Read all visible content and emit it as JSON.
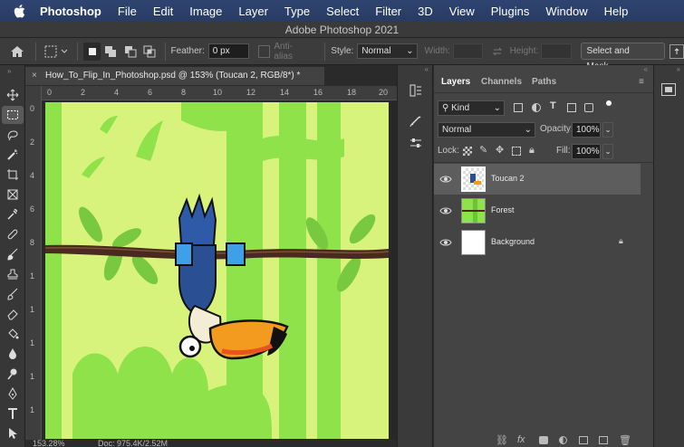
{
  "menubar": {
    "items": [
      "Photoshop",
      "File",
      "Edit",
      "Image",
      "Layer",
      "Type",
      "Select",
      "Filter",
      "3D",
      "View",
      "Plugins",
      "Window",
      "Help"
    ]
  },
  "window": {
    "title": "Adobe Photoshop 2021"
  },
  "options": {
    "feather_label": "Feather:",
    "feather_value": "0 px",
    "antialias_label": "Anti-alias",
    "style_label": "Style:",
    "style_value": "Normal",
    "width_label": "Width:",
    "height_label": "Height:",
    "select_mask_label": "Select and Mask..."
  },
  "document": {
    "tab_title": "How_To_Flip_In_Photoshop.psd @ 153% (Toucan 2, RGB/8*) *",
    "ruler_h": [
      "0",
      "2",
      "4",
      "6",
      "8",
      "10",
      "12",
      "14",
      "16",
      "18",
      "20"
    ],
    "ruler_v": [
      "0",
      "2",
      "4",
      "6",
      "8",
      "1",
      "1",
      "1",
      "1",
      "1"
    ],
    "zoom": "153.28%",
    "doc_size": "Doc: 975.4K/2.52M"
  },
  "layers_panel": {
    "tabs": [
      "Layers",
      "Channels",
      "Paths"
    ],
    "filter_kind": "Kind",
    "blend_mode": "Normal",
    "opacity_label": "Opacity:",
    "opacity_value": "100%",
    "lock_label": "Lock:",
    "fill_label": "Fill:",
    "fill_value": "100%",
    "layers": [
      {
        "name": "Toucan 2",
        "selected": true
      },
      {
        "name": "Forest",
        "selected": false
      },
      {
        "name": "Background",
        "selected": false,
        "locked": true
      }
    ]
  },
  "colors": {
    "menubar": "#2b3f6a",
    "canvas_bg": "#d6f27a",
    "forest": "#8ee04a",
    "branch": "#4a2a1e"
  }
}
